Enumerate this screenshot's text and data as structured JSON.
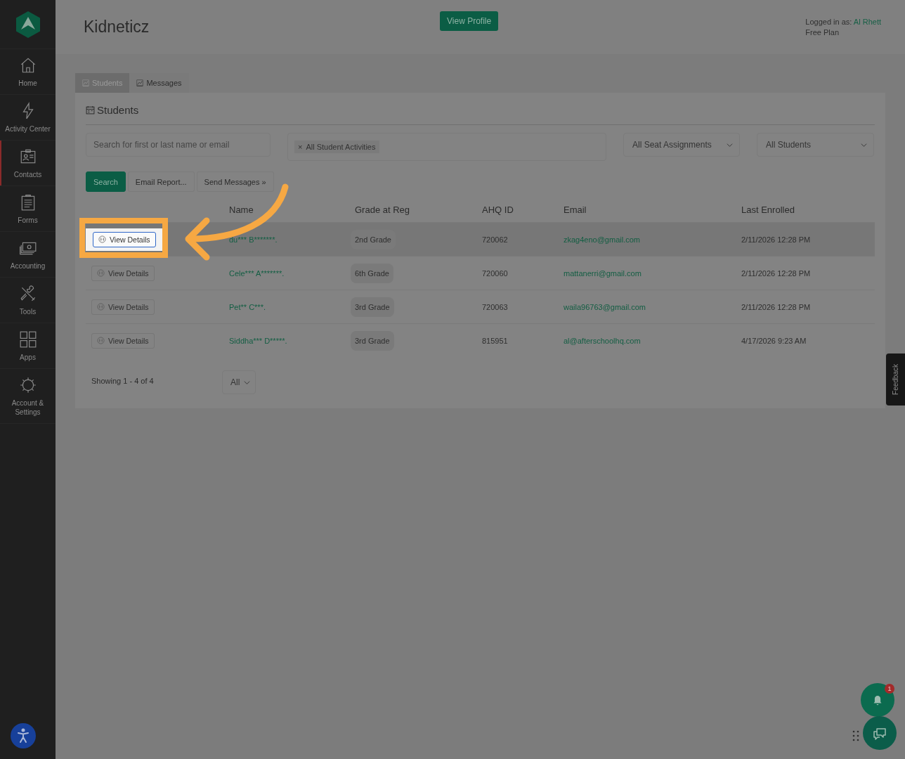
{
  "sidebar": {
    "items": [
      {
        "label": "Home",
        "selected": false
      },
      {
        "label": "Activity Center",
        "selected": false
      },
      {
        "label": "Contacts",
        "selected": true
      },
      {
        "label": "Forms",
        "selected": false
      },
      {
        "label": "Accounting",
        "selected": false
      },
      {
        "label": "Tools",
        "selected": false
      },
      {
        "label": "Apps",
        "selected": false
      },
      {
        "label": "Account & Settings",
        "selected": false
      }
    ]
  },
  "header": {
    "title": "Kidneticz",
    "view_profile": "View Profile",
    "logged_in_label": "Logged in as:",
    "user": "Al Rhett",
    "plan": "Free Plan"
  },
  "tabs": [
    {
      "label": "Students",
      "selected": true
    },
    {
      "label": "Messages",
      "selected": false
    }
  ],
  "panel": {
    "title": "Students",
    "search": {
      "placeholder": "Search for first or last name or email"
    },
    "activity_filter": {
      "chips": [
        {
          "remove": "×",
          "label": "All Student Activities"
        }
      ]
    },
    "selects": [
      "All Seat Assignments",
      "All Students"
    ],
    "buttons": [
      "Search",
      "Email Report...",
      "Send Messages »"
    ]
  },
  "table": {
    "columns": [
      "Name",
      "Grade at Reg",
      "AHQ ID",
      "Email",
      "Last Enrolled"
    ],
    "rows": [
      {
        "action": "View Details",
        "name": "du*** B*******.",
        "grade": "2nd Grade",
        "ahq_id": "720062",
        "email": "zkag4eno@gmail.com",
        "last_enrolled": "2/11/2026 12:28 PM",
        "selected": true,
        "focused": true
      },
      {
        "action": "View Details",
        "name": "Cele*** A*******.",
        "grade": "6th Grade",
        "ahq_id": "720060",
        "email": "mattanerri@gmail.com",
        "last_enrolled": "2/11/2026 12:28 PM",
        "selected": false,
        "focused": false
      },
      {
        "action": "View Details",
        "name": "Pet** C***.",
        "grade": "3rd Grade",
        "ahq_id": "720063",
        "email": "waila96763@gmail.com",
        "last_enrolled": "2/11/2026 12:28 PM",
        "selected": false,
        "focused": false
      },
      {
        "action": "View Details",
        "name": "Siddha*** D*****.",
        "grade": "3rd Grade",
        "ahq_id": "815951",
        "email": "al@afterschoolhq.com",
        "last_enrolled": "4/17/2026 9:23 AM",
        "selected": false,
        "focused": false
      }
    ]
  },
  "footer": {
    "showing": "Showing 1 - 4 of 4",
    "page_size": "All"
  },
  "feedback": "Feedback",
  "notifications": {
    "badge": "1"
  }
}
